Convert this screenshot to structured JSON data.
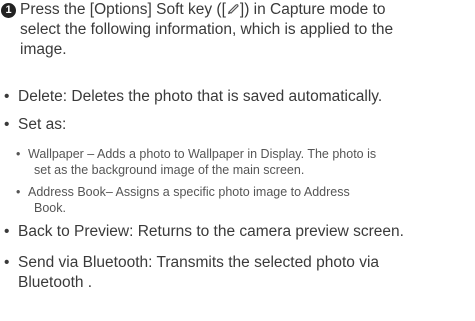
{
  "step": {
    "number": "1",
    "line1_before": "Press the [Options] Soft key ([",
    "line1_after": "]) in Capture mode to",
    "line2": "select the following information, which is applied to the",
    "line3": "image."
  },
  "items": {
    "delete": "Delete: Deletes the photo that is saved automatically.",
    "set_as": "Set as:",
    "wallpaper_l1": "Wallpaper – Adds a photo to Wallpaper in Display. The photo is",
    "wallpaper_l2": "set as the background image of the main screen.",
    "address_l1": "Address Book– Assigns a specific photo image to Address",
    "address_l2": "Book.",
    "back": "Back to Preview: Returns to the camera preview screen.",
    "send_l1": "Send via Bluetooth: Transmits the selected photo via",
    "send_l2": "Bluetooth ."
  },
  "bullet": "•",
  "icons": {
    "softkey": "options-softkey-icon"
  }
}
